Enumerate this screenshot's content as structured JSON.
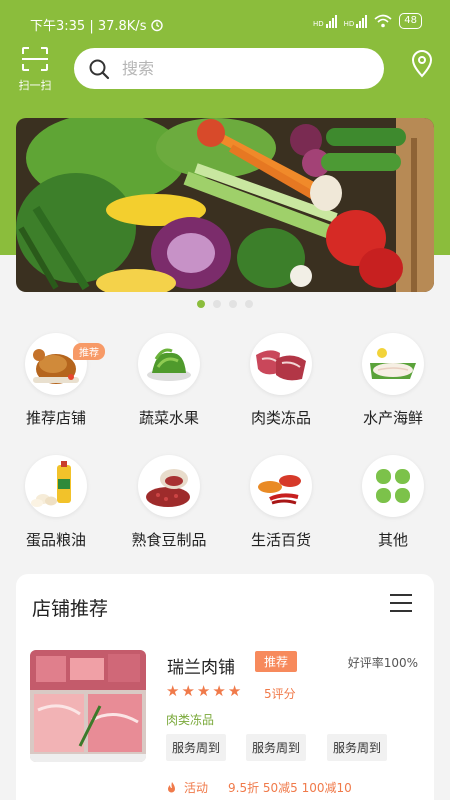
{
  "statusbar": {
    "time_speed": "下午3:35 | 37.8K/s",
    "battery": "48",
    "network_1": "HD",
    "network_2": "HD"
  },
  "header": {
    "scan_label": "扫一扫",
    "search_placeholder": "搜索"
  },
  "banner": {
    "slide_count": 4,
    "active_slide": 0
  },
  "categories": [
    {
      "label": "推荐店铺",
      "badge": "推荐",
      "icon": "roast-chicken-icon"
    },
    {
      "label": "蔬菜水果",
      "icon": "vegetables-icon"
    },
    {
      "label": "肉类冻品",
      "icon": "meat-icon"
    },
    {
      "label": "水产海鲜",
      "icon": "fish-icon"
    },
    {
      "label": "蛋品粮油",
      "icon": "eggs-oil-icon"
    },
    {
      "label": "熟食豆制品",
      "icon": "beans-icon"
    },
    {
      "label": "生活百货",
      "icon": "spices-icon"
    },
    {
      "label": "其他",
      "icon": "grid-four-icon"
    }
  ],
  "shop_section": {
    "title": "店铺推荐",
    "shop": {
      "name": "瑞兰肉铺",
      "badge": "推荐",
      "good_rate": "好评率100%",
      "stars": 5,
      "score": "5评分",
      "category": "肉类冻品",
      "services": [
        "服务周到",
        "服务周到",
        "服务周到"
      ],
      "activity_label": "活动",
      "activity_text": "9.5折 50减5 100减10"
    }
  },
  "colors": {
    "brand_green": "#8bbd3c",
    "accent_orange": "#f07a4a"
  }
}
